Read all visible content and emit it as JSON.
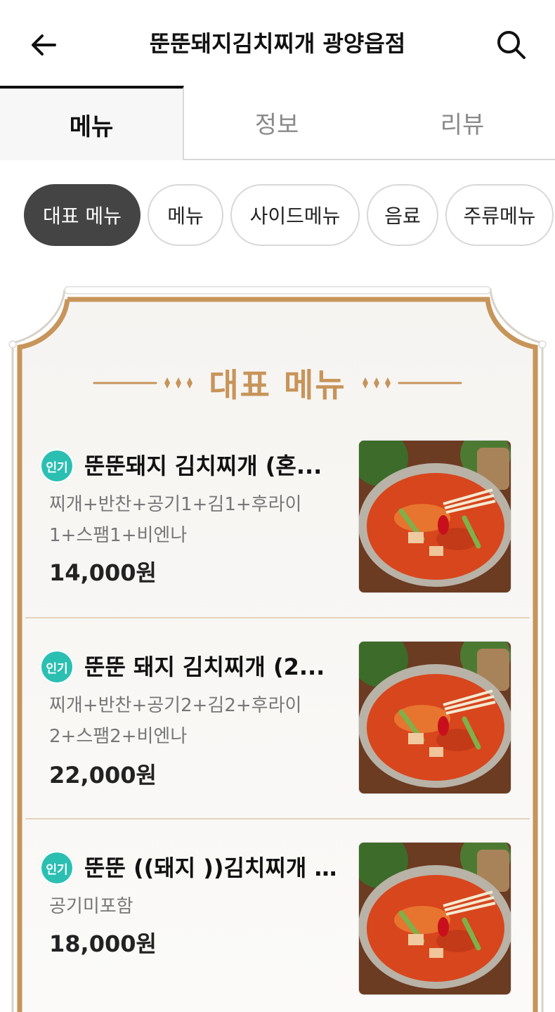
{
  "header": {
    "title": "뚠뚠돼지김치찌개 광양읍점"
  },
  "tabs": [
    {
      "label": "메뉴",
      "active": true
    },
    {
      "label": "정보",
      "active": false
    },
    {
      "label": "리뷰",
      "active": false
    }
  ],
  "categories": [
    {
      "label": "대표 메뉴",
      "active": true
    },
    {
      "label": "메뉴",
      "active": false
    },
    {
      "label": "사이드메뉴",
      "active": false
    },
    {
      "label": "음료",
      "active": false
    },
    {
      "label": "주류메뉴",
      "active": false
    }
  ],
  "section": {
    "title": "대표 메뉴"
  },
  "items": [
    {
      "badge": "인기",
      "name": "뚠뚠돼지 김치찌개 (혼...",
      "desc": "찌개+반찬+공기1+김1+후라이1+스팸1+비엔나",
      "price": "14,000원"
    },
    {
      "badge": "인기",
      "name": "뚠뚠 돼지 김치찌개 (2...",
      "desc": "찌개+반찬+공기2+김2+후라이2+스팸2+비엔나",
      "price": "22,000원"
    },
    {
      "badge": "인기",
      "name": "뚠뚠 ((돼지 ))김치찌개 (...",
      "desc": "공기미포함",
      "price": "18,000원"
    }
  ],
  "colors": {
    "accent_gold": "#c7945a",
    "badge_teal": "#2bbfb2",
    "chip_active": "#444444"
  }
}
